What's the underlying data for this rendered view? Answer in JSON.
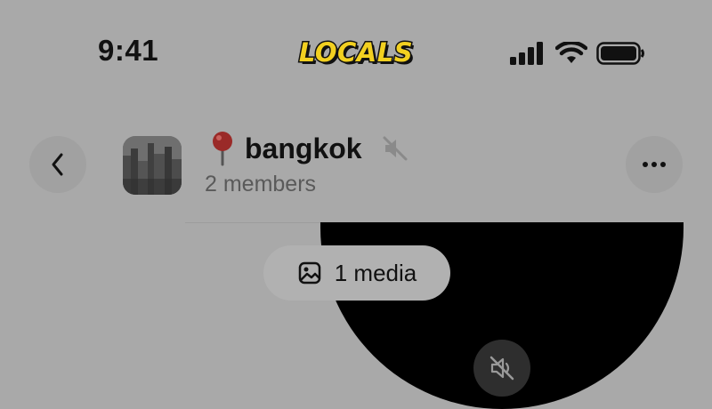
{
  "status_bar": {
    "time": "9:41",
    "brand": "LOCALS",
    "icons": [
      "cellular-signal-icon",
      "wifi-icon",
      "battery-icon"
    ]
  },
  "header": {
    "back_icon": "chevron-left-icon",
    "title": "bangkok",
    "title_emoji_icon": "round-pushpin-icon",
    "muted_icon": "speaker-muted-icon",
    "members": "2 members",
    "more_icon": "ellipsis-icon"
  },
  "media": {
    "pill_label": "1 media",
    "pill_icon": "image-icon",
    "video_mute_icon": "speaker-muted-icon"
  },
  "colors": {
    "brand_yellow": "#f2d020",
    "overlay_gray": "#a9a9a9"
  }
}
